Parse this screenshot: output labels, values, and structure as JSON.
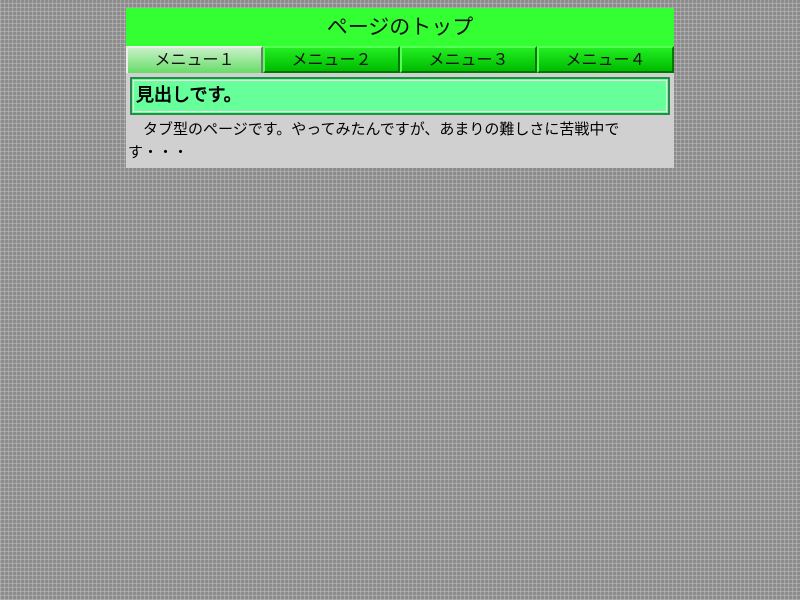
{
  "header": {
    "title": "ページのトップ"
  },
  "tabs": [
    {
      "label": "メニュー１",
      "active": true
    },
    {
      "label": "メニュー２",
      "active": false
    },
    {
      "label": "メニュー３",
      "active": false
    },
    {
      "label": "メニュー４",
      "active": false
    }
  ],
  "content": {
    "heading": "見出しです。",
    "text": "タブ型のページです。やってみたんですが、あまりの難しさに苦戦中です・・・"
  },
  "colors": {
    "header_bg": "#33ff33",
    "tab_bg": "#00cc00",
    "active_tab_bg": "#99e899",
    "heading_bg": "#66ff99",
    "content_bg": "#d0d0d0",
    "page_bg": "#8c8c8c"
  }
}
